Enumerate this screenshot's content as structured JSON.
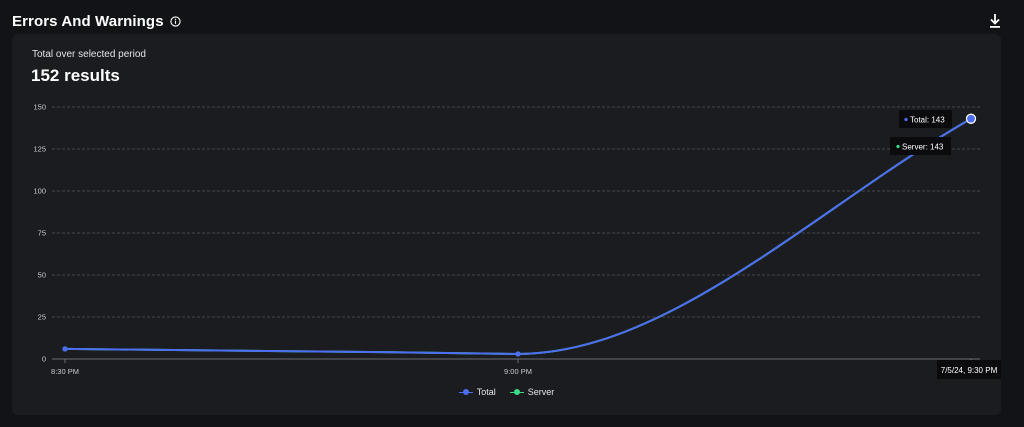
{
  "header": {
    "title": "Errors And Warnings",
    "info_icon": "info-circle-icon",
    "download_icon": "download-icon"
  },
  "card": {
    "subtitle": "Total over selected period",
    "total": "152 results"
  },
  "colors": {
    "total": "#4d6ef2",
    "server": "#3ddc84",
    "grid": "#55575e",
    "tooltip_bg": "#0b0b0d"
  },
  "chart_data": {
    "type": "line",
    "x": [
      "8:30 PM",
      "9:00 PM",
      "9:30 PM"
    ],
    "x_tick_labels": [
      "8:30 PM",
      "9:00 PM",
      ""
    ],
    "series": [
      {
        "name": "Total",
        "values": [
          6,
          3,
          143
        ]
      },
      {
        "name": "Server",
        "values": [
          6,
          3,
          143
        ]
      }
    ],
    "ylim": [
      0,
      150
    ],
    "yticks": [
      0,
      25,
      50,
      75,
      100,
      125,
      150
    ],
    "grid": true,
    "legend": "bottom-center",
    "tooltip": {
      "x_label": "7/5/24, 9:30 PM",
      "entries": [
        "Total: 143",
        "Server: 143"
      ]
    }
  },
  "legend": {
    "items": [
      {
        "label": "Total"
      },
      {
        "label": "Server"
      }
    ]
  }
}
